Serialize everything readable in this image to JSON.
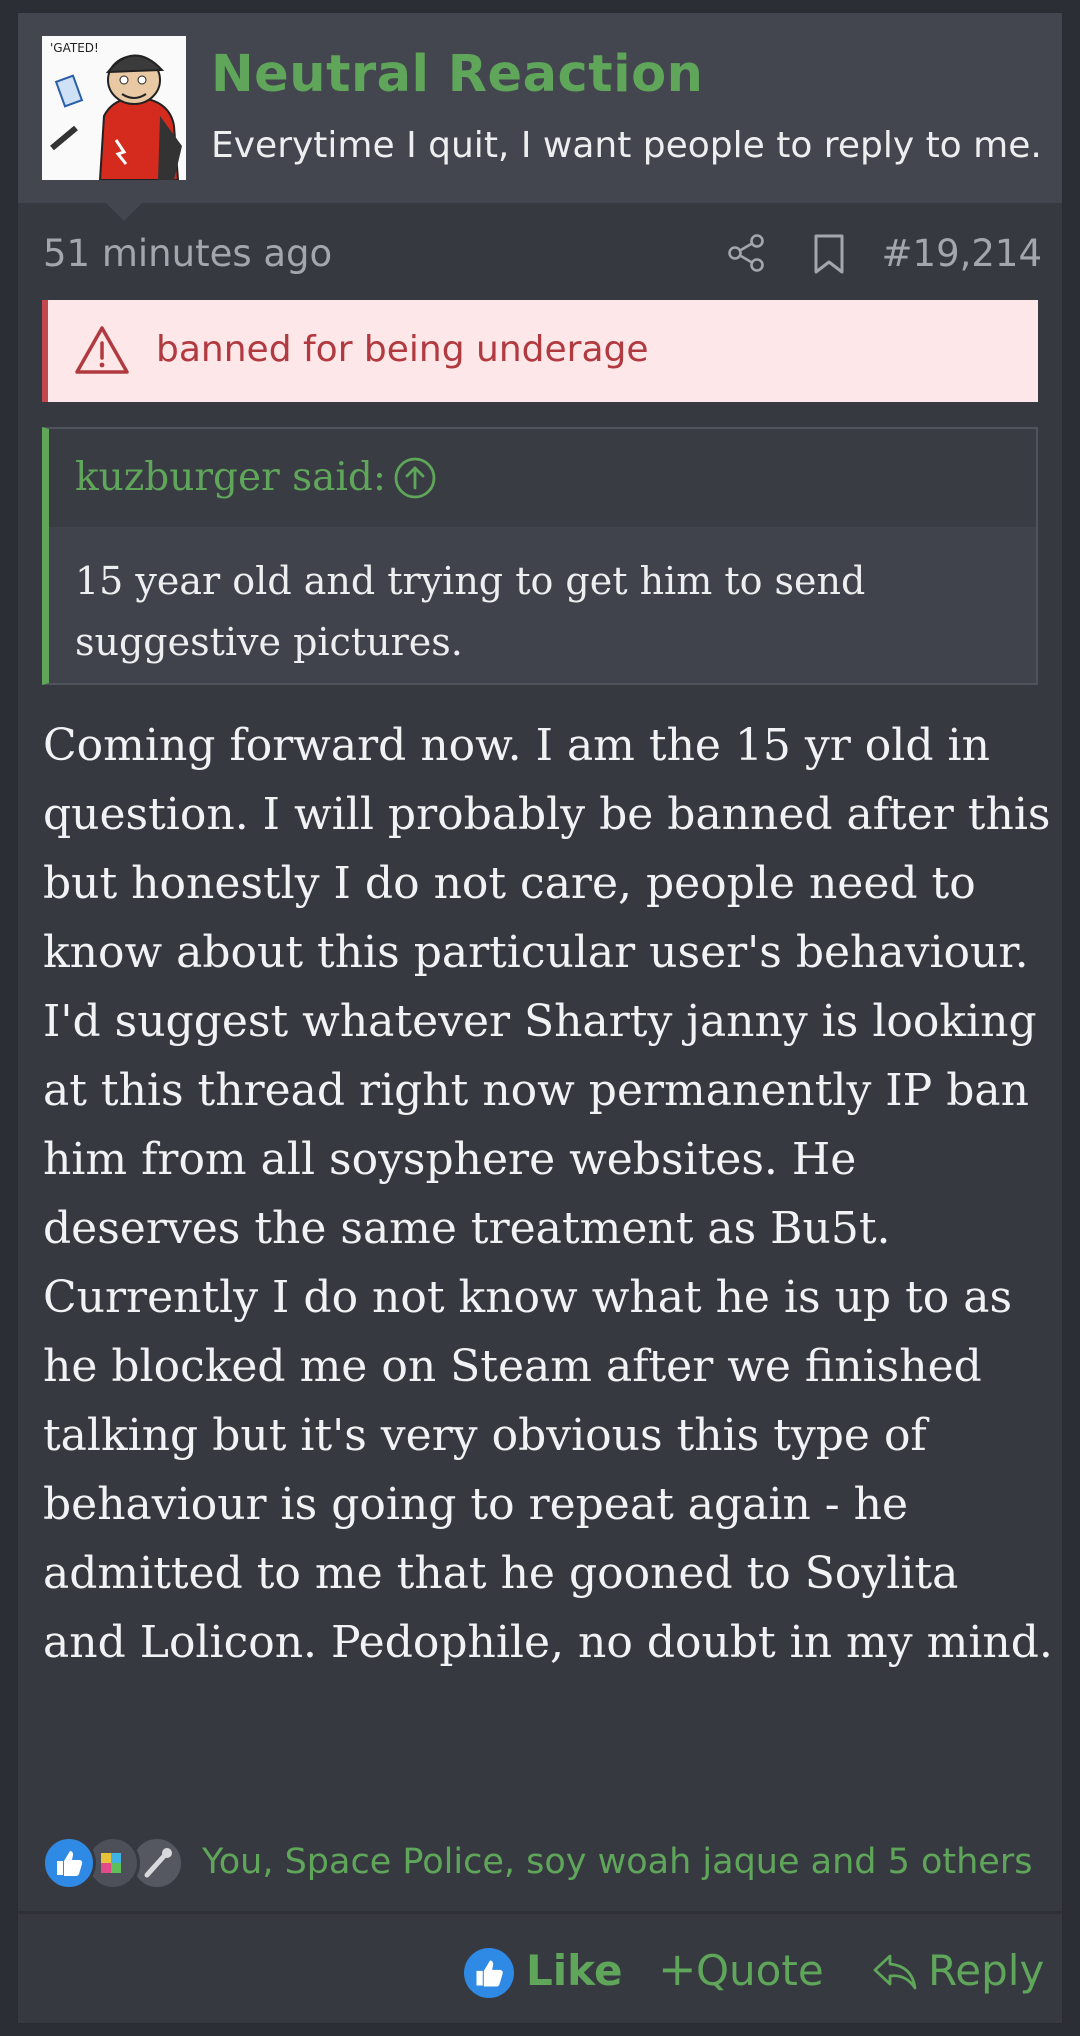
{
  "user": {
    "name": "Neutral Reaction",
    "title": "Everytime I quit, I want people to reply to me.",
    "avatar_text": "'GATED!"
  },
  "meta": {
    "time": "51 minutes ago",
    "post_number": "#19,214"
  },
  "warning": {
    "text": "banned for being underage"
  },
  "quote": {
    "author": "kuzburger said:",
    "text": "15 year old and trying to get him to send suggestive pictures."
  },
  "message": {
    "paragraphs": [
      "Coming forward now. I am the 15 yr old in question. I will probably be banned after this but honestly I do not care, people need to know about this particular user's behaviour. I'd suggest whatever Sharty janny is looking at this thread right now permanently IP ban him from all soysphere websites. He deserves the same treatment as Bu5t.",
      "Currently I do not know what he is up to as he blocked me on Steam after we finished talking but it's very obvious this type of behaviour is going to repeat again - he admitted to me that he gooned to Soylita and Lolicon. Pedophile, no doubt in my mind."
    ]
  },
  "reactions": {
    "icons": [
      "like-icon",
      "puzzle-icon",
      "wrench-icon"
    ],
    "list": "You, Space Police, soy woah jaque and 5 others"
  },
  "actions": {
    "like": "Like",
    "quote": "Quote",
    "reply": "Reply"
  },
  "colors": {
    "accent": "#5fa65a",
    "warning_bg": "#fde7e8",
    "warning_text": "#b13a40",
    "background": "#363940"
  }
}
